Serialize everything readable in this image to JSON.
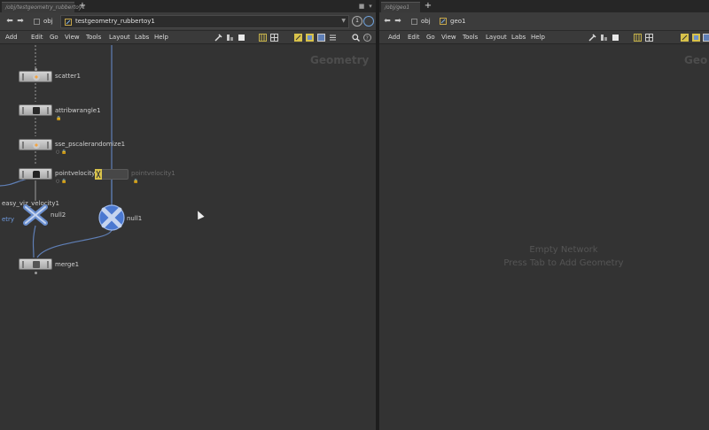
{
  "left_pane": {
    "tab_label": "/obj/testgeometry_rubbertoy1",
    "path": {
      "root": "obj",
      "node": "testgeometry_rubbertoy1"
    },
    "quick_mark": "1",
    "menu": [
      "Add",
      "Edit",
      "Go",
      "View",
      "Tools",
      "Layout",
      "Labs",
      "Help"
    ],
    "watermark": "Geometry",
    "nodes": {
      "scatter": "scatter1",
      "attribwrangle": "attribwrangle1",
      "sse_pscale": "sse_pscalerandomize1",
      "pointvelocity": "pointvelocity1",
      "pointvelocity_ghost": "pointvelocity1",
      "null2": "null2",
      "null1": "null1",
      "merge": "merge1",
      "easy_viz": "easy_viz_velocity1",
      "offscreen_label": "etry"
    }
  },
  "right_pane": {
    "tab_label": "/obj/geo1",
    "path": {
      "root": "obj",
      "node": "geo1"
    },
    "menu": [
      "Add",
      "Edit",
      "Go",
      "View",
      "Tools",
      "Layout",
      "Labs",
      "Help"
    ],
    "watermark": "Geo",
    "empty_line1": "Empty Network",
    "empty_line2": "Press Tab to Add Geometry"
  },
  "colors": {
    "canvas": "#333333",
    "wire_blue": "#5f7fb6",
    "selected_null": "#4a78d0",
    "display_flag": "#d8c24a"
  }
}
